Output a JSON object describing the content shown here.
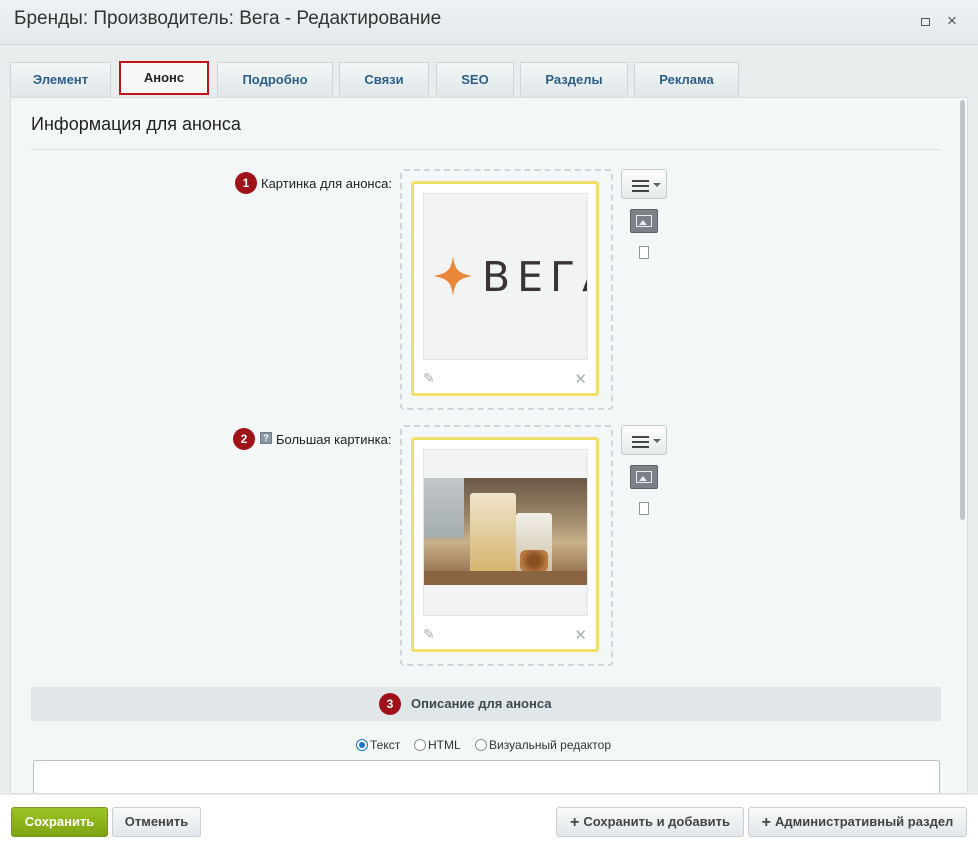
{
  "window": {
    "title": "Бренды: Производитель: Вега - Редактирование",
    "maximize_icon": "maximize-icon",
    "close_icon": "×"
  },
  "tabs": [
    {
      "label": "Элемент",
      "active": false
    },
    {
      "label": "Анонс",
      "active": true
    },
    {
      "label": "Подробно",
      "active": false
    },
    {
      "label": "Связи",
      "active": false
    },
    {
      "label": "SEO",
      "active": false
    },
    {
      "label": "Разделы",
      "active": false
    },
    {
      "label": "Реклама",
      "active": false
    }
  ],
  "section": {
    "title": "Информация для анонса"
  },
  "fields": {
    "preview_picture": {
      "badge": "1",
      "label": "Картинка для анонса:",
      "logo_text": "ВЕГА"
    },
    "detail_picture": {
      "badge": "2",
      "help": "?",
      "label": "Большая картинка:"
    },
    "preview_text": {
      "badge": "3",
      "title": "Описание для анонса",
      "modes": [
        {
          "label": "Текст",
          "checked": true
        },
        {
          "label": "HTML",
          "checked": false
        },
        {
          "label": "Визуальный редактор",
          "checked": false
        }
      ],
      "value": ""
    }
  },
  "footer": {
    "save": "Сохранить",
    "cancel": "Отменить",
    "save_add": "Сохранить и добавить",
    "admin_section": "Административный раздел"
  },
  "colors": {
    "badge": "#a0121a",
    "active_tab_border": "#c0141a",
    "image_frame": "#f2df6b",
    "primary_button": "#8db41c",
    "logo_star": "#e8873a"
  }
}
